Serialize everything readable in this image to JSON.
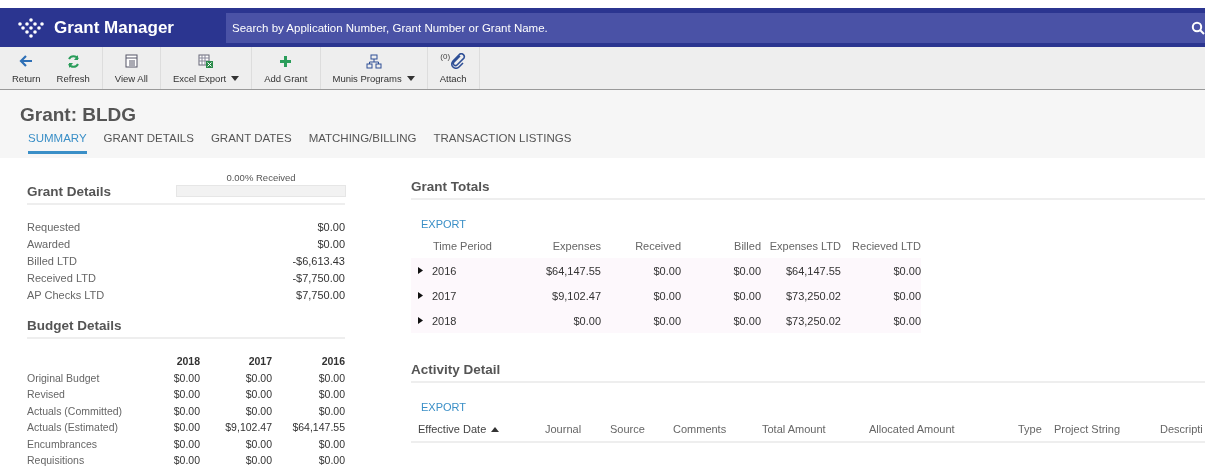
{
  "header": {
    "app_title": "Grant Manager",
    "search": {
      "placeholder": "Search by Application Number, Grant Number or Grant Name."
    }
  },
  "toolbar": [
    {
      "kind": "return",
      "label": "Return",
      "dropdown": false
    },
    {
      "kind": "refresh",
      "label": "Refresh",
      "dropdown": false
    },
    {
      "kind": "view",
      "label": "View All",
      "dropdown": false
    },
    {
      "kind": "export",
      "label": "Excel Export",
      "dropdown": true
    },
    {
      "kind": "add",
      "label": "Add Grant",
      "dropdown": false
    },
    {
      "kind": "programs",
      "label": "Munis Programs",
      "dropdown": true
    },
    {
      "kind": "attach",
      "label": "Attach",
      "dropdown": false,
      "count": "(0)"
    }
  ],
  "page_title": "Grant: BLDG",
  "tabs": [
    {
      "label": "SUMMARY",
      "selected": true
    },
    {
      "label": "GRANT DETAILS",
      "selected": false
    },
    {
      "label": "GRANT DATES",
      "selected": false
    },
    {
      "label": "MATCHING/BILLING",
      "selected": false
    },
    {
      "label": "TRANSACTION LISTINGS",
      "selected": false
    }
  ],
  "grant_details": {
    "title": "Grant Details",
    "progress": {
      "label": "0.00% Received",
      "level": 0
    },
    "rows": [
      {
        "label": "Requested",
        "value": "$0.00"
      },
      {
        "label": "Awarded",
        "value": "$0.00"
      },
      {
        "label": "Billed LTD",
        "value": "-$6,613.43"
      },
      {
        "label": "Received LTD",
        "value": "-$7,750.00"
      },
      {
        "label": "AP Checks LTD",
        "value": "$7,750.00"
      }
    ]
  },
  "budget_details": {
    "title": "Budget Details",
    "columns": [
      "2018",
      "2017",
      "2016"
    ],
    "rows": [
      {
        "label": "Original Budget",
        "values": [
          "$0.00",
          "$0.00",
          "$0.00"
        ]
      },
      {
        "label": "Revised",
        "values": [
          "$0.00",
          "$0.00",
          "$0.00"
        ]
      },
      {
        "label": "Actuals (Committed)",
        "values": [
          "$0.00",
          "$0.00",
          "$0.00"
        ]
      },
      {
        "label": "Actuals (Estimated)",
        "values": [
          "$0.00",
          "$9,102.47",
          "$64,147.55"
        ]
      },
      {
        "label": "Encumbrances",
        "values": [
          "$0.00",
          "$0.00",
          "$0.00"
        ]
      },
      {
        "label": "Requisitions",
        "values": [
          "$0.00",
          "$0.00",
          "$0.00"
        ]
      }
    ]
  },
  "grant_totals": {
    "title": "Grant Totals",
    "export": "EXPORT",
    "columns": [
      "Time Period",
      "Expenses",
      "Received",
      "Billed",
      "Expenses LTD",
      "Recieved LTD"
    ],
    "rows": [
      {
        "expanded": false,
        "cells": [
          "2016",
          "$64,147.55",
          "$0.00",
          "$0.00",
          "$64,147.55",
          "$0.00"
        ]
      },
      {
        "expanded": false,
        "cells": [
          "2017",
          "$9,102.47",
          "$0.00",
          "$0.00",
          "$73,250.02",
          "$0.00"
        ]
      },
      {
        "expanded": false,
        "cells": [
          "2018",
          "$0.00",
          "$0.00",
          "$0.00",
          "$73,250.02",
          "$0.00"
        ]
      }
    ]
  },
  "activity_detail": {
    "title": "Activity Detail",
    "export": "EXPORT",
    "columns": [
      {
        "label": "Effective Date",
        "sorted": true
      },
      {
        "label": "Journal",
        "sorted": false
      },
      {
        "label": "Source",
        "sorted": false
      },
      {
        "label": "Comments",
        "sorted": false
      },
      {
        "label": "Total Amount",
        "sorted": false
      },
      {
        "label": "Allocated Amount",
        "sorted": false
      },
      {
        "label": "Type",
        "sorted": false
      },
      {
        "label": "Project String",
        "sorted": false
      },
      {
        "label": "Descripti",
        "sorted": false
      }
    ]
  }
}
